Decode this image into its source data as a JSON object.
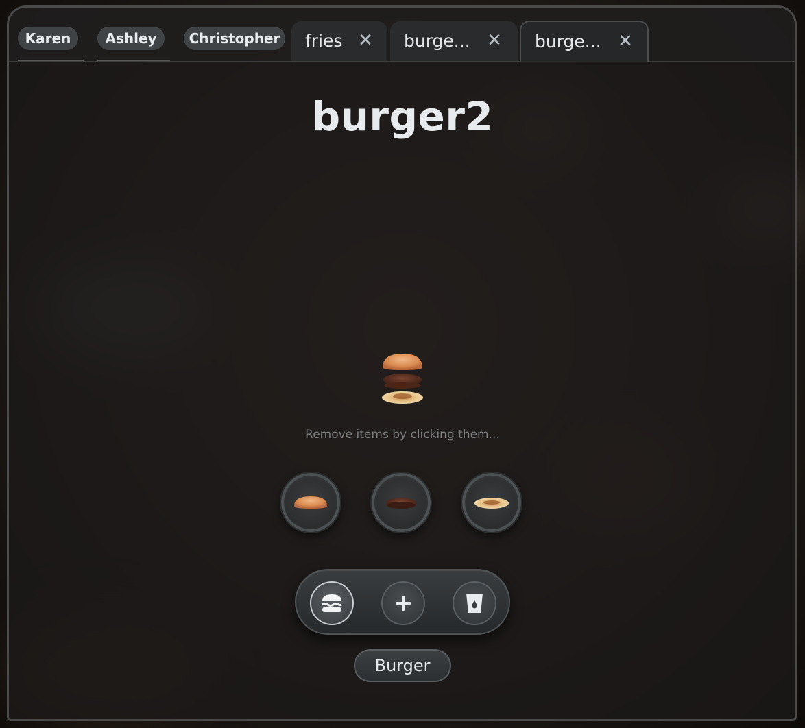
{
  "colors": {
    "accent": "#c9ced2",
    "title": "#e8ebee",
    "hint": "#7d7f81"
  },
  "users": [
    "Karen",
    "Ashley",
    "Christopher"
  ],
  "tabs": [
    {
      "label": "fries",
      "active": false
    },
    {
      "label": "burge...",
      "active": false
    },
    {
      "label": "burge...",
      "active": true
    }
  ],
  "main": {
    "title": "burger2",
    "hint": "Remove items by clicking them...",
    "ingredients": [
      "bun-top-icon",
      "patty-icon",
      "bun-bottom-icon"
    ]
  },
  "toolbar": {
    "tools": [
      "burger-icon",
      "plus-icon",
      "drink-icon"
    ],
    "category_label": "Burger"
  }
}
